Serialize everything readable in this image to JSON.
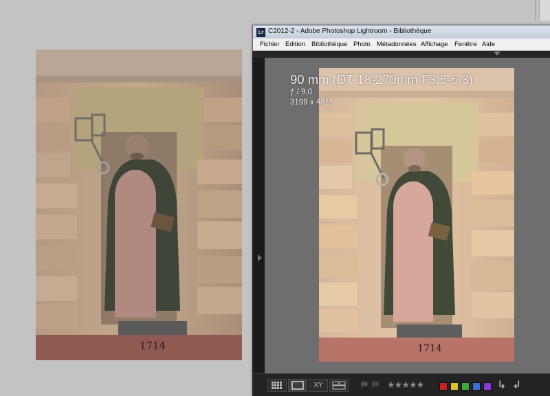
{
  "window": {
    "title": "C2012-2 - Adobe Photoshop Lightroom - Bibliothèque",
    "app_icon_label": "Lr"
  },
  "menu": [
    "Fichier",
    "Edition",
    "Bibliothèque",
    "Photo",
    "Métadonnées",
    "Affichage",
    "Fenêtre",
    "Aide"
  ],
  "photo_info": {
    "lens": "90 mm (DT 18-270mm F3.5-6.3)",
    "aperture": "ƒ / 9,0",
    "dimensions": "3199 x 4815"
  },
  "plinth_engraving": "1714",
  "toolbar": {
    "compare_label": "XY",
    "rating": "★★★★★",
    "color_labels": [
      "#cc2222",
      "#d8c52c",
      "#3aa83a",
      "#3b6fd6",
      "#8a3ad6"
    ]
  }
}
